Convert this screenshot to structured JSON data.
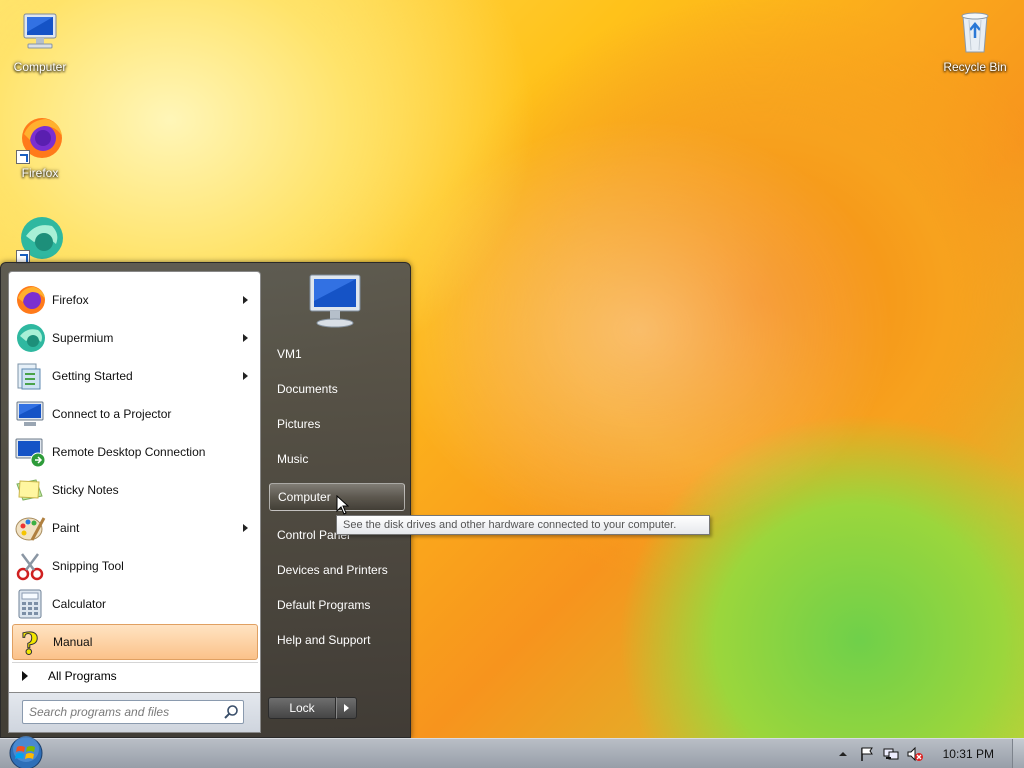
{
  "desktop": {
    "icons": [
      {
        "label": "Computer"
      },
      {
        "label": "Firefox"
      },
      {
        "label": ""
      },
      {
        "label": "Recycle Bin"
      }
    ]
  },
  "start_menu": {
    "programs": [
      {
        "label": "Firefox",
        "icon": "firefox-icon",
        "has_submenu": true
      },
      {
        "label": "Supermium",
        "icon": "supermium-icon",
        "has_submenu": true
      },
      {
        "label": "Getting Started",
        "icon": "getting-started-icon",
        "has_submenu": true
      },
      {
        "label": "Connect to a Projector",
        "icon": "projector-icon",
        "has_submenu": false
      },
      {
        "label": "Remote Desktop Connection",
        "icon": "remote-desktop-icon",
        "has_submenu": false
      },
      {
        "label": "Sticky Notes",
        "icon": "sticky-notes-icon",
        "has_submenu": false
      },
      {
        "label": "Paint",
        "icon": "paint-icon",
        "has_submenu": true
      },
      {
        "label": "Snipping Tool",
        "icon": "snipping-tool-icon",
        "has_submenu": false
      },
      {
        "label": "Calculator",
        "icon": "calculator-icon",
        "has_submenu": false
      },
      {
        "label": "Manual",
        "icon": "help-question-icon",
        "has_submenu": false,
        "highlighted": true
      }
    ],
    "all_programs_label": "All Programs",
    "search": {
      "placeholder": "Search programs and files",
      "value": ""
    },
    "right_items": [
      {
        "label": "VM1"
      },
      {
        "label": "Documents"
      },
      {
        "label": "Pictures"
      },
      {
        "label": "Music"
      },
      {
        "label": "Computer",
        "hovered": true
      },
      {
        "label": "Control Panel"
      },
      {
        "label": "Devices and Printers"
      },
      {
        "label": "Default Programs"
      },
      {
        "label": "Help and Support"
      }
    ],
    "lock_label": "Lock",
    "tooltip": "See the disk drives and other hardware connected to your computer."
  },
  "taskbar": {
    "clock": "10:31 PM",
    "tray_icons": [
      "show-hidden-icons-arrow",
      "action-center-flag-icon",
      "network-icon",
      "volume-muted-icon"
    ]
  },
  "colors": {
    "highlight": "#fbc28a",
    "menu_dark": "#454545",
    "taskbar": "#a8aeb7"
  }
}
